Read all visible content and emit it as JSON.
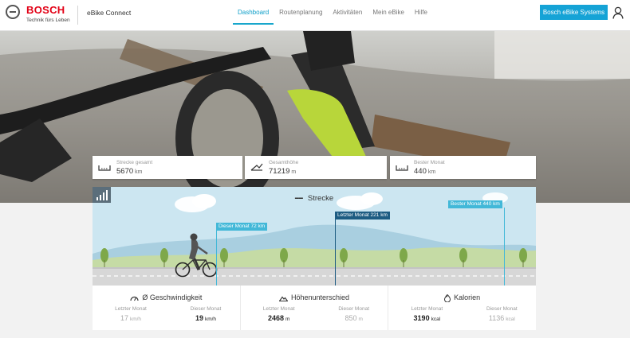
{
  "header": {
    "brand": "BOSCH",
    "tagline": "Technik fürs Leben",
    "app_name": "eBike Connect",
    "nav": [
      "Dashboard",
      "Routenplanung",
      "Aktivitäten",
      "Mein eBike",
      "Hilfe"
    ],
    "active_nav": "Dashboard",
    "cta": "Bosch eBike Systems",
    "accent": "#15a3d6"
  },
  "stats": [
    {
      "label": "Strecke gesamt",
      "value": "5670",
      "unit": "km",
      "icon": "distance-icon"
    },
    {
      "label": "Gesamthöhe",
      "value": "71219",
      "unit": "m",
      "icon": "elevation-icon"
    },
    {
      "label": "Bester Monat",
      "value": "440",
      "unit": "km",
      "icon": "distance-icon"
    }
  ],
  "panel": {
    "title": "Strecke",
    "flags": {
      "this_month": {
        "label": "Dieser Monat 72 km",
        "value_km": 72,
        "color": "#42b8d8"
      },
      "last_month": {
        "label": "Letzter Monat 221 km",
        "value_km": 221,
        "color": "#1d5c82"
      },
      "best_month": {
        "label": "Bester Monat 440 km",
        "value_km": 440,
        "color": "#42b8d8"
      }
    }
  },
  "metrics": [
    {
      "title": "Ø Geschwindigkeit",
      "icon": "speedometer-icon",
      "left": {
        "label": "Letzter Monat",
        "value": "17",
        "unit": "km/h"
      },
      "right": {
        "label": "Dieser Monat",
        "value": "19",
        "unit": "km/h"
      }
    },
    {
      "title": "Höhenunterschied",
      "icon": "mountain-icon",
      "left": {
        "label": "Letzter Monat",
        "value": "2468",
        "unit": "m"
      },
      "right": {
        "label": "Dieser Monat",
        "value": "850",
        "unit": "m"
      }
    },
    {
      "title": "Kalorien",
      "icon": "flame-icon",
      "left": {
        "label": "Letzter Monat",
        "value": "3190",
        "unit": "kcal"
      },
      "right": {
        "label": "Dieser Monat",
        "value": "1136",
        "unit": "kcal"
      }
    }
  ]
}
